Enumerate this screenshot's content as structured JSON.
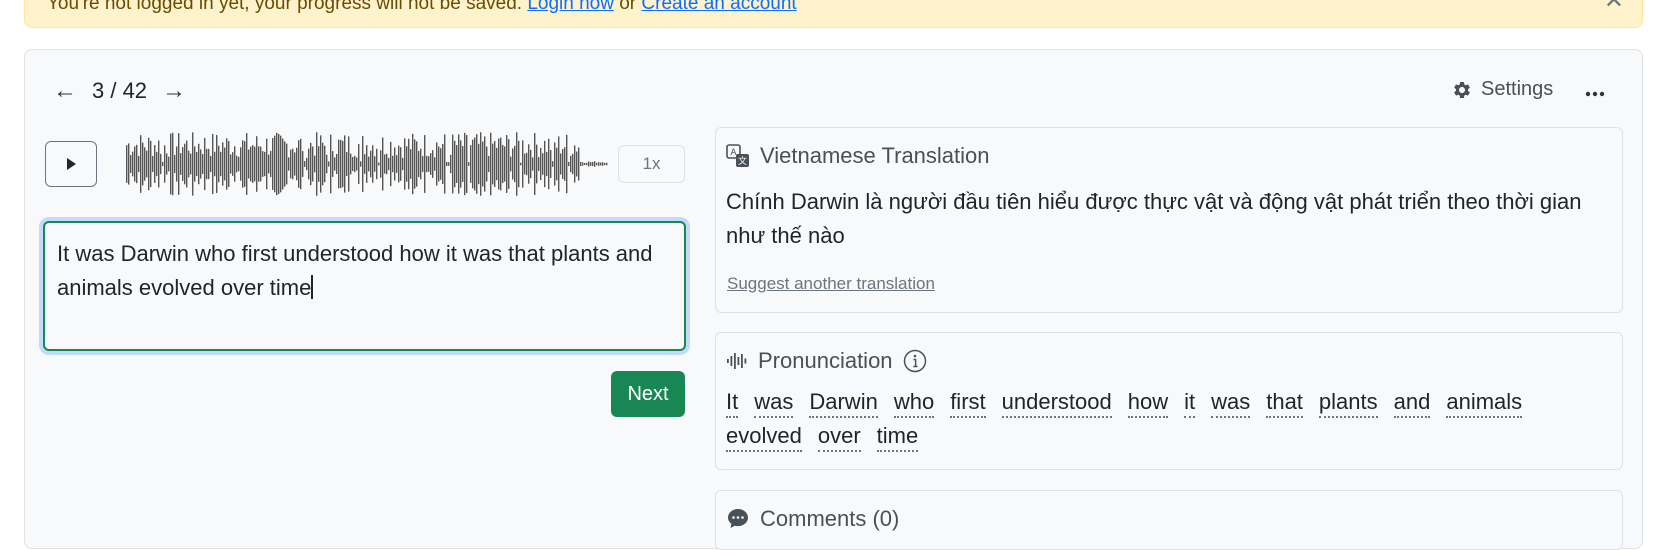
{
  "banner": {
    "message": "You're not logged in yet, your progress will not be saved.",
    "login_link": "Login now",
    "or_text": "or",
    "create_link": "Create an account",
    "close_icon": "close-icon"
  },
  "nav": {
    "prev_icon": "arrow-left-icon",
    "position": "3 / 42",
    "next_icon": "arrow-right-icon"
  },
  "toolbar": {
    "settings_label": "Settings",
    "settings_icon": "gear-icon",
    "more_icon": "ellipsis-icon"
  },
  "player": {
    "play_icon": "play-icon",
    "speed": "1x"
  },
  "answer": {
    "value": "It was Darwin who first understood how it was that plants and animals evolved over time"
  },
  "next_button": {
    "label": "Next"
  },
  "translation": {
    "title": "Vietnamese Translation",
    "text": "Chính Darwin là người đầu tiên hiểu được thực vật và động vật phát triển theo thời gian như thế nào",
    "suggest_link": "Suggest another translation",
    "icon": "translate-icon"
  },
  "pronunciation": {
    "title": "Pronunciation",
    "icon": "audio-wave-icon",
    "info_icon": "info-icon",
    "words": [
      "It",
      "was",
      "Darwin",
      "who",
      "first",
      "understood",
      "how",
      "it",
      "was",
      "that",
      "plants",
      "and",
      "animals",
      "evolved",
      "over",
      "time"
    ]
  },
  "comments": {
    "title": "Comments (0)",
    "icon": "comment-icon"
  },
  "colors": {
    "primary_green": "#198754",
    "banner_bg": "#fff3cd",
    "link_blue": "#0d6efd",
    "panel_bg": "#f8f9fa"
  }
}
